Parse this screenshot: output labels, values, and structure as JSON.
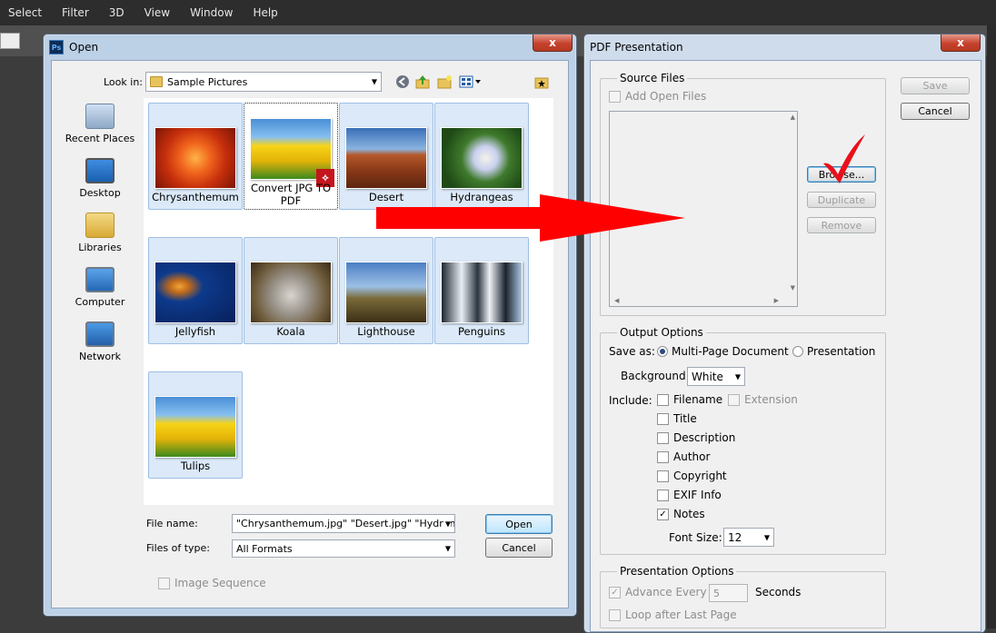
{
  "menubar": [
    "Select",
    "Filter",
    "3D",
    "View",
    "Window",
    "Help"
  ],
  "open_dialog": {
    "title": "Open",
    "close_label": "x",
    "look_in_label": "Look in:",
    "look_in_value": "Sample Pictures",
    "places": [
      "Recent Places",
      "Desktop",
      "Libraries",
      "Computer",
      "Network"
    ],
    "files": [
      {
        "name": "Chrysanthemum",
        "selected": false
      },
      {
        "name": "Convert JPG TO PDF",
        "selected": true
      },
      {
        "name": "Desert",
        "selected": false
      },
      {
        "name": "Hydrangeas",
        "selected": false
      },
      {
        "name": "Jellyfish",
        "selected": false
      },
      {
        "name": "Koala",
        "selected": false
      },
      {
        "name": "Lighthouse",
        "selected": false
      },
      {
        "name": "Penguins",
        "selected": false
      },
      {
        "name": "Tulips",
        "selected": false
      }
    ],
    "file_name_label": "File name:",
    "file_name_value": "\"Chrysanthemum.jpg\" \"Desert.jpg\" \"Hydrangea",
    "file_type_label": "Files of type:",
    "file_type_value": "All Formats",
    "open_label": "Open",
    "cancel_label": "Cancel",
    "image_sequence_label": "Image Sequence"
  },
  "pdf_dialog": {
    "title": "PDF Presentation",
    "close_label": "x",
    "save_label": "Save",
    "cancel_label": "Cancel",
    "source_files_title": "Source Files",
    "add_open_files_label": "Add Open Files",
    "browse_label": "Browse...",
    "duplicate_label": "Duplicate",
    "remove_label": "Remove",
    "output_options_title": "Output Options",
    "save_as_label": "Save as:",
    "multi_page_label": "Multi-Page Document",
    "presentation_label": "Presentation",
    "background_label": "Background:",
    "background_value": "White",
    "include_label": "Include:",
    "include_items": [
      {
        "label": "Filename",
        "checked": false
      },
      {
        "label": "Title",
        "checked": false
      },
      {
        "label": "Description",
        "checked": false
      },
      {
        "label": "Author",
        "checked": false
      },
      {
        "label": "Copyright",
        "checked": false
      },
      {
        "label": "EXIF Info",
        "checked": false
      },
      {
        "label": "Notes",
        "checked": true
      }
    ],
    "extension_label": "Extension",
    "font_size_label": "Font Size:",
    "font_size_value": "12",
    "presentation_options_title": "Presentation Options",
    "advance_every_label": "Advance Every",
    "advance_value": "5",
    "seconds_label": "Seconds",
    "loop_label": "Loop after Last Page"
  },
  "colors": {
    "arrow": "#ff0000",
    "checkmark": "#e8101a",
    "tile_bg": "#dbe9f8",
    "default_btn": "#3c7fb1"
  }
}
